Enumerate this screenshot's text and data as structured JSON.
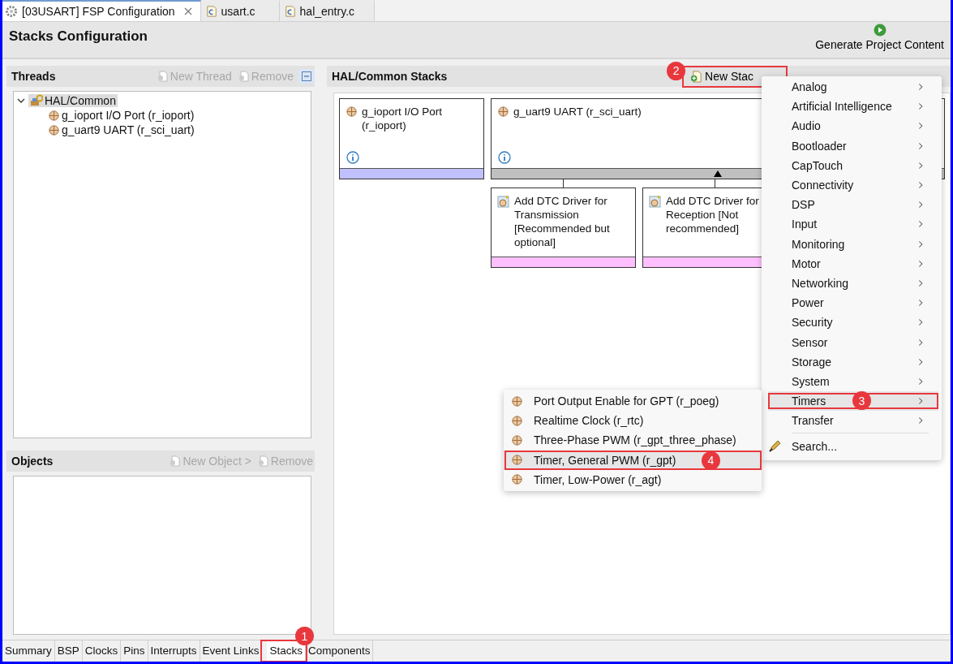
{
  "editor_tabs": [
    {
      "label": "[03USART] FSP Configuration",
      "kind": "config",
      "selected": true,
      "closable": true
    },
    {
      "label": "usart.c",
      "kind": "cfile",
      "selected": false,
      "closable": false
    },
    {
      "label": "hal_entry.c",
      "kind": "cfile",
      "selected": false,
      "closable": false
    }
  ],
  "header": {
    "title": "Stacks Configuration",
    "action": "Generate Project Content"
  },
  "threads": {
    "title": "Threads",
    "buttons": [
      {
        "label": "New Thread",
        "disabled": true
      },
      {
        "label": "Remove",
        "disabled": true
      }
    ],
    "tree": [
      {
        "label": "HAL/Common",
        "selected": true,
        "expanded": true,
        "children": [
          {
            "label": "g_ioport I/O Port (r_ioport)",
            "selected": false
          },
          {
            "label": "g_uart9 UART (r_sci_uart)",
            "selected": false
          }
        ]
      }
    ]
  },
  "objects": {
    "title": "Objects",
    "buttons": [
      {
        "label": "New Object >",
        "disabled": true
      },
      {
        "label": "Remove",
        "disabled": true
      }
    ]
  },
  "stacks": {
    "title": "HAL/Common Stacks",
    "new_stack": {
      "label": "New Stac",
      "annotation": "2"
    },
    "cards": [
      {
        "title": "g_ioport I/O Port (r_ioport)",
        "color": "#c0c0ff"
      },
      {
        "title": "g_uart9 UART (r_sci_uart)",
        "color": "#c0c0c0",
        "children": [
          {
            "title": "Add DTC Driver for Transmission [Recommended but optional]",
            "color": "#ffc0ff"
          },
          {
            "title": "Add DTC Driver for Reception [Not recommended]",
            "color": "#ffc0ff"
          }
        ]
      }
    ]
  },
  "menu": {
    "items": [
      {
        "label": "Analog",
        "selected": false
      },
      {
        "label": "Artificial Intelligence",
        "selected": false
      },
      {
        "label": "Audio",
        "selected": false
      },
      {
        "label": "Bootloader",
        "selected": false
      },
      {
        "label": "CapTouch",
        "selected": false
      },
      {
        "label": "Connectivity",
        "selected": false
      },
      {
        "label": "DSP",
        "selected": false
      },
      {
        "label": "Input",
        "selected": false
      },
      {
        "label": "Monitoring",
        "selected": false
      },
      {
        "label": "Motor",
        "selected": false
      },
      {
        "label": "Networking",
        "selected": false
      },
      {
        "label": "Power",
        "selected": false
      },
      {
        "label": "Security",
        "selected": false
      },
      {
        "label": "Sensor",
        "selected": false
      },
      {
        "label": "Storage",
        "selected": false
      },
      {
        "label": "System",
        "selected": false
      },
      {
        "label": "Timers",
        "selected": true,
        "annotation": "3"
      },
      {
        "label": "Transfer",
        "selected": false
      }
    ],
    "search": "Search..."
  },
  "submenu": [
    {
      "label": "Port Output Enable for GPT (r_poeg)",
      "selected": false
    },
    {
      "label": "Realtime Clock (r_rtc)",
      "selected": false
    },
    {
      "label": "Three-Phase PWM (r_gpt_three_phase)",
      "selected": false
    },
    {
      "label": "Timer, General PWM (r_gpt)",
      "selected": true,
      "annotation": "4"
    },
    {
      "label": "Timer, Low-Power (r_agt)",
      "selected": false
    }
  ],
  "bottom_tabs": [
    {
      "label": "Summary",
      "selected": false
    },
    {
      "label": "BSP",
      "selected": false
    },
    {
      "label": "Clocks",
      "selected": false
    },
    {
      "label": "Pins",
      "selected": false
    },
    {
      "label": "Interrupts",
      "selected": false
    },
    {
      "label": "Event Links",
      "selected": false
    },
    {
      "label": "Stacks",
      "selected": true,
      "annotation": "1"
    },
    {
      "label": "Components",
      "selected": false
    }
  ]
}
